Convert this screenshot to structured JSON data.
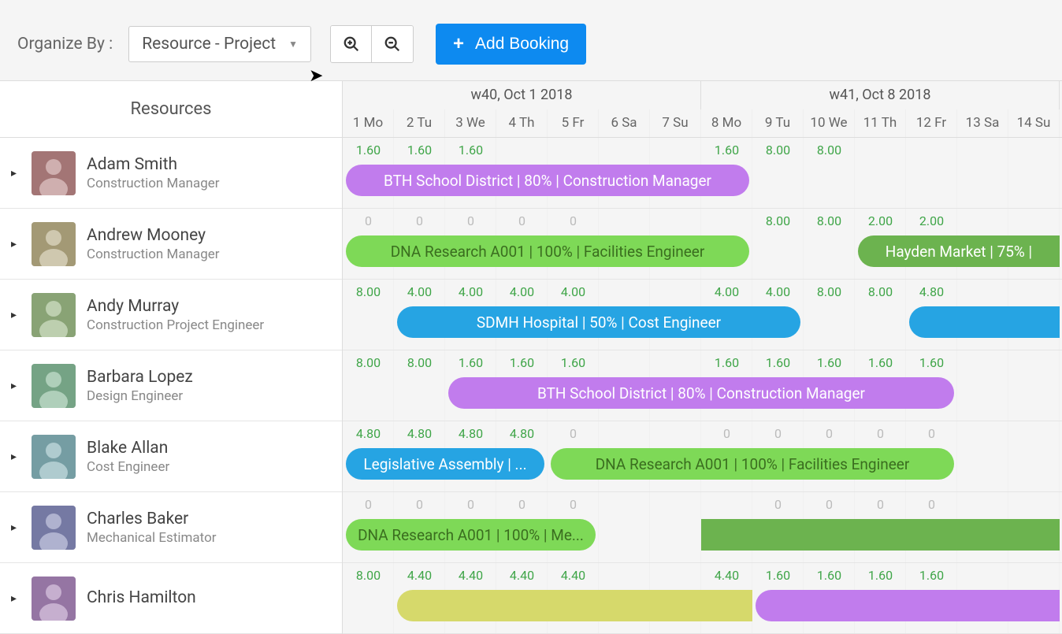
{
  "toolbar": {
    "organize_label": "Organize By :",
    "dropdown_value": "Resource - Project",
    "add_booking_label": "Add Booking"
  },
  "timeline": {
    "resources_header": "Resources",
    "weeks": [
      {
        "label": "w40, Oct 1 2018",
        "span": 7
      },
      {
        "label": "w41, Oct 8 2018",
        "span": 7
      }
    ],
    "days": [
      "1 Mo",
      "2 Tu",
      "3 We",
      "4 Th",
      "5 Fr",
      "6 Sa",
      "7 Su",
      "8 Mo",
      "9 Tu",
      "10 We",
      "11 Th",
      "12 Fr",
      "13 Sa",
      "14 Su"
    ]
  },
  "resources": [
    {
      "name": "Adam Smith",
      "role": "Construction Manager",
      "hours": [
        "1.60",
        "1.60",
        "1.60",
        "",
        "",
        "",
        "",
        "1.60",
        "8.00",
        "8.00",
        "",
        "",
        "",
        ""
      ],
      "hour_colors": [
        "g",
        "g",
        "g",
        "",
        "",
        "",
        "",
        "g",
        "g",
        "g",
        "",
        "",
        "",
        ""
      ],
      "bookings": [
        {
          "label": "BTH School District | 80% | Construction Manager",
          "start": 0,
          "span": 8,
          "color": "purple",
          "rounded": "both"
        }
      ]
    },
    {
      "name": "Andrew Mooney",
      "role": "Construction Manager",
      "hours": [
        "0",
        "0",
        "0",
        "0",
        "0",
        "",
        "",
        "",
        "8.00",
        "8.00",
        "2.00",
        "2.00",
        "",
        ""
      ],
      "hour_colors": [
        "x",
        "x",
        "x",
        "x",
        "x",
        "",
        "",
        "",
        "g",
        "g",
        "g",
        "g",
        "",
        ""
      ],
      "bookings": [
        {
          "label": "DNA Research A001 | 100% | Facilities Engineer",
          "start": 0,
          "span": 8,
          "color": "green",
          "rounded": "both"
        },
        {
          "label": "Hayden Market | 75% | ",
          "start": 10,
          "span": 4,
          "color": "darkgreen",
          "rounded": "left"
        }
      ]
    },
    {
      "name": "Andy Murray",
      "role": "Construction Project Engineer",
      "hours": [
        "8.00",
        "4.00",
        "4.00",
        "4.00",
        "4.00",
        "",
        "",
        "4.00",
        "4.00",
        "8.00",
        "8.00",
        "4.80",
        "",
        ""
      ],
      "hour_colors": [
        "g",
        "g",
        "g",
        "g",
        "g",
        "",
        "",
        "g",
        "g",
        "g",
        "g",
        "g",
        "",
        ""
      ],
      "bookings": [
        {
          "label": "SDMH Hospital | 50% | Cost Engineer",
          "start": 1,
          "span": 8,
          "color": "blue",
          "rounded": "both"
        },
        {
          "label": "",
          "start": 11,
          "span": 3,
          "color": "blue",
          "rounded": "left"
        }
      ]
    },
    {
      "name": "Barbara Lopez",
      "role": "Design Engineer",
      "hours": [
        "8.00",
        "8.00",
        "1.60",
        "1.60",
        "1.60",
        "",
        "",
        "1.60",
        "1.60",
        "1.60",
        "1.60",
        "1.60",
        "",
        ""
      ],
      "hour_colors": [
        "g",
        "g",
        "g",
        "g",
        "g",
        "",
        "",
        "g",
        "g",
        "g",
        "g",
        "g",
        "",
        ""
      ],
      "bookings": [
        {
          "label": "BTH School District | 80% | Construction Manager",
          "start": 2,
          "span": 10,
          "color": "purple",
          "rounded": "both"
        }
      ]
    },
    {
      "name": "Blake Allan",
      "role": "Cost Engineer",
      "hours": [
        "4.80",
        "4.80",
        "4.80",
        "4.80",
        "0",
        "",
        "",
        "0",
        "0",
        "0",
        "0",
        "0",
        "",
        ""
      ],
      "hour_colors": [
        "g",
        "g",
        "g",
        "g",
        "x",
        "",
        "",
        "x",
        "x",
        "x",
        "x",
        "x",
        "",
        ""
      ],
      "bookings": [
        {
          "label": "Legislative Assembly | ...",
          "start": 0,
          "span": 4,
          "color": "blue",
          "rounded": "both"
        },
        {
          "label": "DNA Research A001 | 100% | Facilities Engineer",
          "start": 4,
          "span": 8,
          "color": "green",
          "rounded": "both"
        }
      ]
    },
    {
      "name": "Charles Baker",
      "role": "Mechanical Estimator",
      "hours": [
        "0",
        "0",
        "0",
        "0",
        "0",
        "",
        "",
        "",
        "0",
        "0",
        "0",
        "0",
        "",
        ""
      ],
      "hour_colors": [
        "x",
        "x",
        "x",
        "x",
        "x",
        "",
        "",
        "",
        "x",
        "x",
        "x",
        "x",
        "",
        ""
      ],
      "bookings": [
        {
          "label": "DNA Research A001 | 100% | Me...",
          "start": 0,
          "span": 5,
          "color": "green",
          "rounded": "both"
        },
        {
          "label": "",
          "start": 7,
          "span": 7,
          "color": "darkgreen",
          "rounded": "none"
        }
      ]
    },
    {
      "name": "Chris Hamilton",
      "role": "",
      "hours": [
        "8.00",
        "4.40",
        "4.40",
        "4.40",
        "4.40",
        "",
        "",
        "4.40",
        "1.60",
        "1.60",
        "1.60",
        "1.60",
        "",
        ""
      ],
      "hour_colors": [
        "g",
        "g",
        "g",
        "g",
        "g",
        "",
        "",
        "g",
        "g",
        "g",
        "g",
        "g",
        "",
        ""
      ],
      "bookings": [
        {
          "label": "",
          "start": 1,
          "span": 7,
          "color": "yellow",
          "rounded": "left"
        },
        {
          "label": "",
          "start": 8,
          "span": 6,
          "color": "purple",
          "rounded": "left"
        }
      ]
    }
  ],
  "colors": {
    "purple": "#c17ced",
    "green_bg": "#7ed957",
    "green_text": "#3a6e1f",
    "darkgreen": "#6cb34f",
    "blue": "#26a4e3",
    "yellow": "#d6d96b",
    "accent": "#0d8af0"
  }
}
